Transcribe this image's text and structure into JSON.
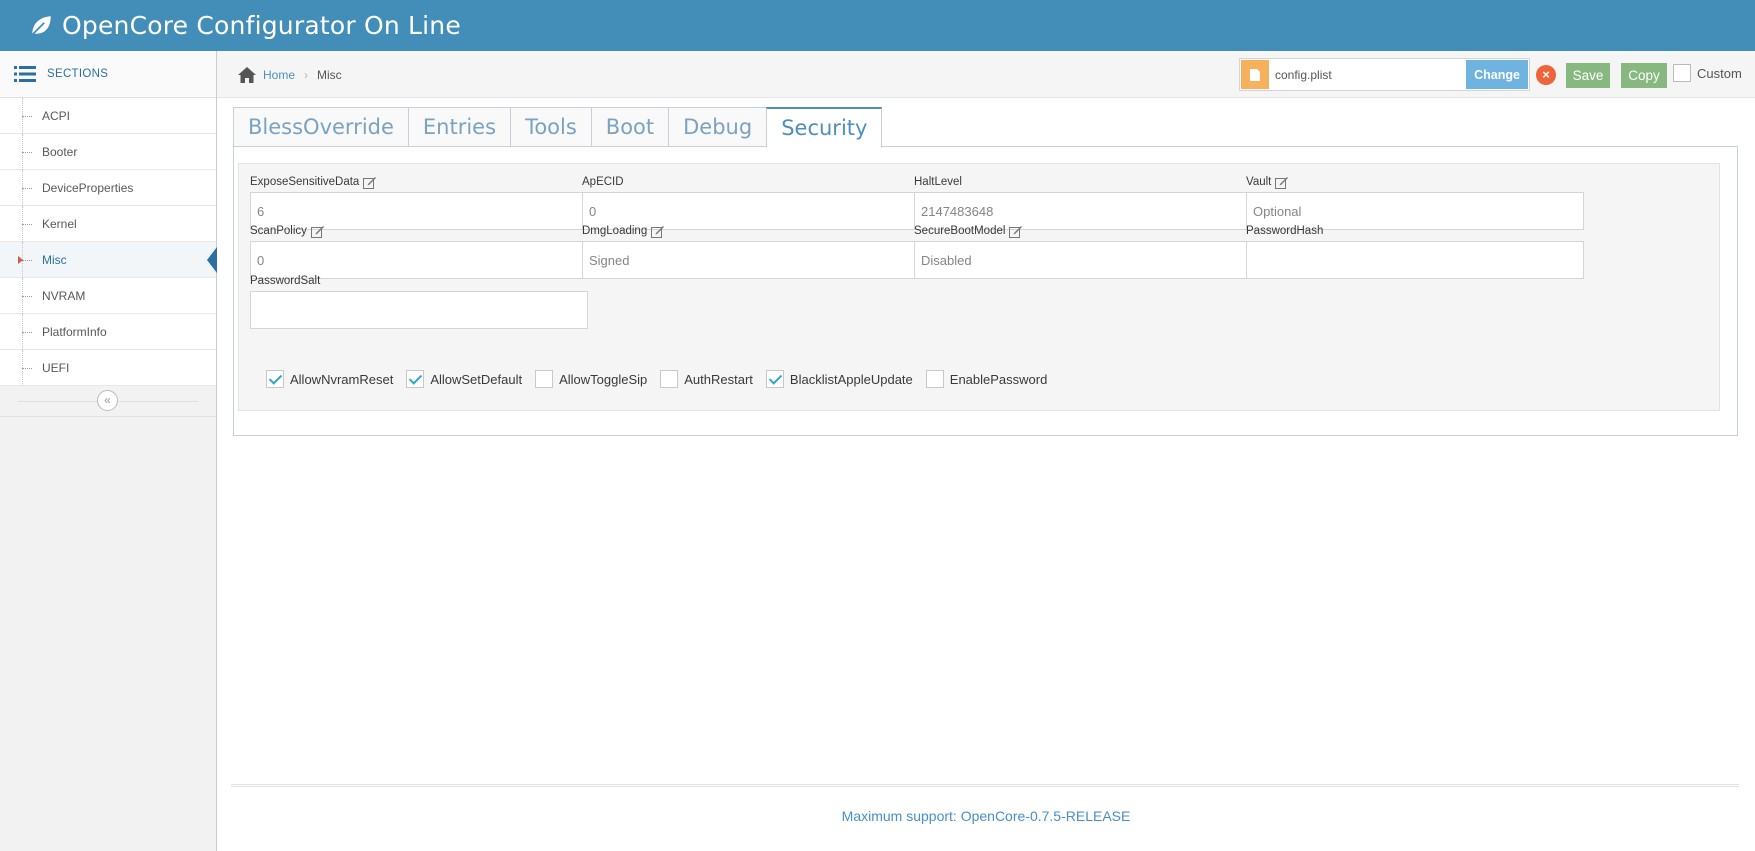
{
  "app": {
    "title": "OpenCore Configurator On Line"
  },
  "sidebar": {
    "header": "SECTIONS",
    "items": [
      {
        "label": "ACPI"
      },
      {
        "label": "Booter"
      },
      {
        "label": "DeviceProperties"
      },
      {
        "label": "Kernel"
      },
      {
        "label": "Misc",
        "active": true
      },
      {
        "label": "NVRAM"
      },
      {
        "label": "PlatformInfo"
      },
      {
        "label": "UEFI"
      }
    ],
    "collapse_glyph": "«"
  },
  "breadcrumb": {
    "home": "Home",
    "separator": "›",
    "current": "Misc"
  },
  "toolbar": {
    "file_name": "config.plist",
    "change_label": "Change",
    "close_glyph": "×",
    "save_label": "Save",
    "copy_label": "Copy",
    "custom_label": "Custom",
    "custom_checked": false
  },
  "tabs": [
    {
      "label": "BlessOverride"
    },
    {
      "label": "Entries"
    },
    {
      "label": "Tools"
    },
    {
      "label": "Boot"
    },
    {
      "label": "Debug"
    },
    {
      "label": "Security",
      "active": true
    }
  ],
  "security": {
    "fields": [
      {
        "label": "ExposeSensitiveData",
        "value": "6",
        "editable_icon": true
      },
      {
        "label": "ApECID",
        "value": "0",
        "editable_icon": false
      },
      {
        "label": "HaltLevel",
        "value": "2147483648",
        "editable_icon": false
      },
      {
        "label": "Vault",
        "value": "Optional",
        "editable_icon": true
      },
      {
        "label": "ScanPolicy",
        "value": "0",
        "editable_icon": true
      },
      {
        "label": "DmgLoading",
        "value": "Signed",
        "editable_icon": true
      },
      {
        "label": "SecureBootModel",
        "value": "Disabled",
        "editable_icon": true
      },
      {
        "label": "PasswordHash",
        "value": "",
        "editable_icon": false
      },
      {
        "label": "PasswordSalt",
        "value": "",
        "editable_icon": false
      }
    ],
    "checkboxes": [
      {
        "label": "AllowNvramReset",
        "checked": true
      },
      {
        "label": "AllowSetDefault",
        "checked": true
      },
      {
        "label": "AllowToggleSip",
        "checked": false
      },
      {
        "label": "AuthRestart",
        "checked": false
      },
      {
        "label": "BlacklistAppleUpdate",
        "checked": true
      },
      {
        "label": "EnablePassword",
        "checked": false
      }
    ]
  },
  "footer": {
    "text": "Maximum support: OpenCore-0.7.5-RELEASE"
  },
  "colors": {
    "navbar": "#438eb9",
    "accent": "#4c8fbd",
    "save": "#87b87f",
    "file_icon": "#f7b05b",
    "danger": "#f0643c"
  }
}
